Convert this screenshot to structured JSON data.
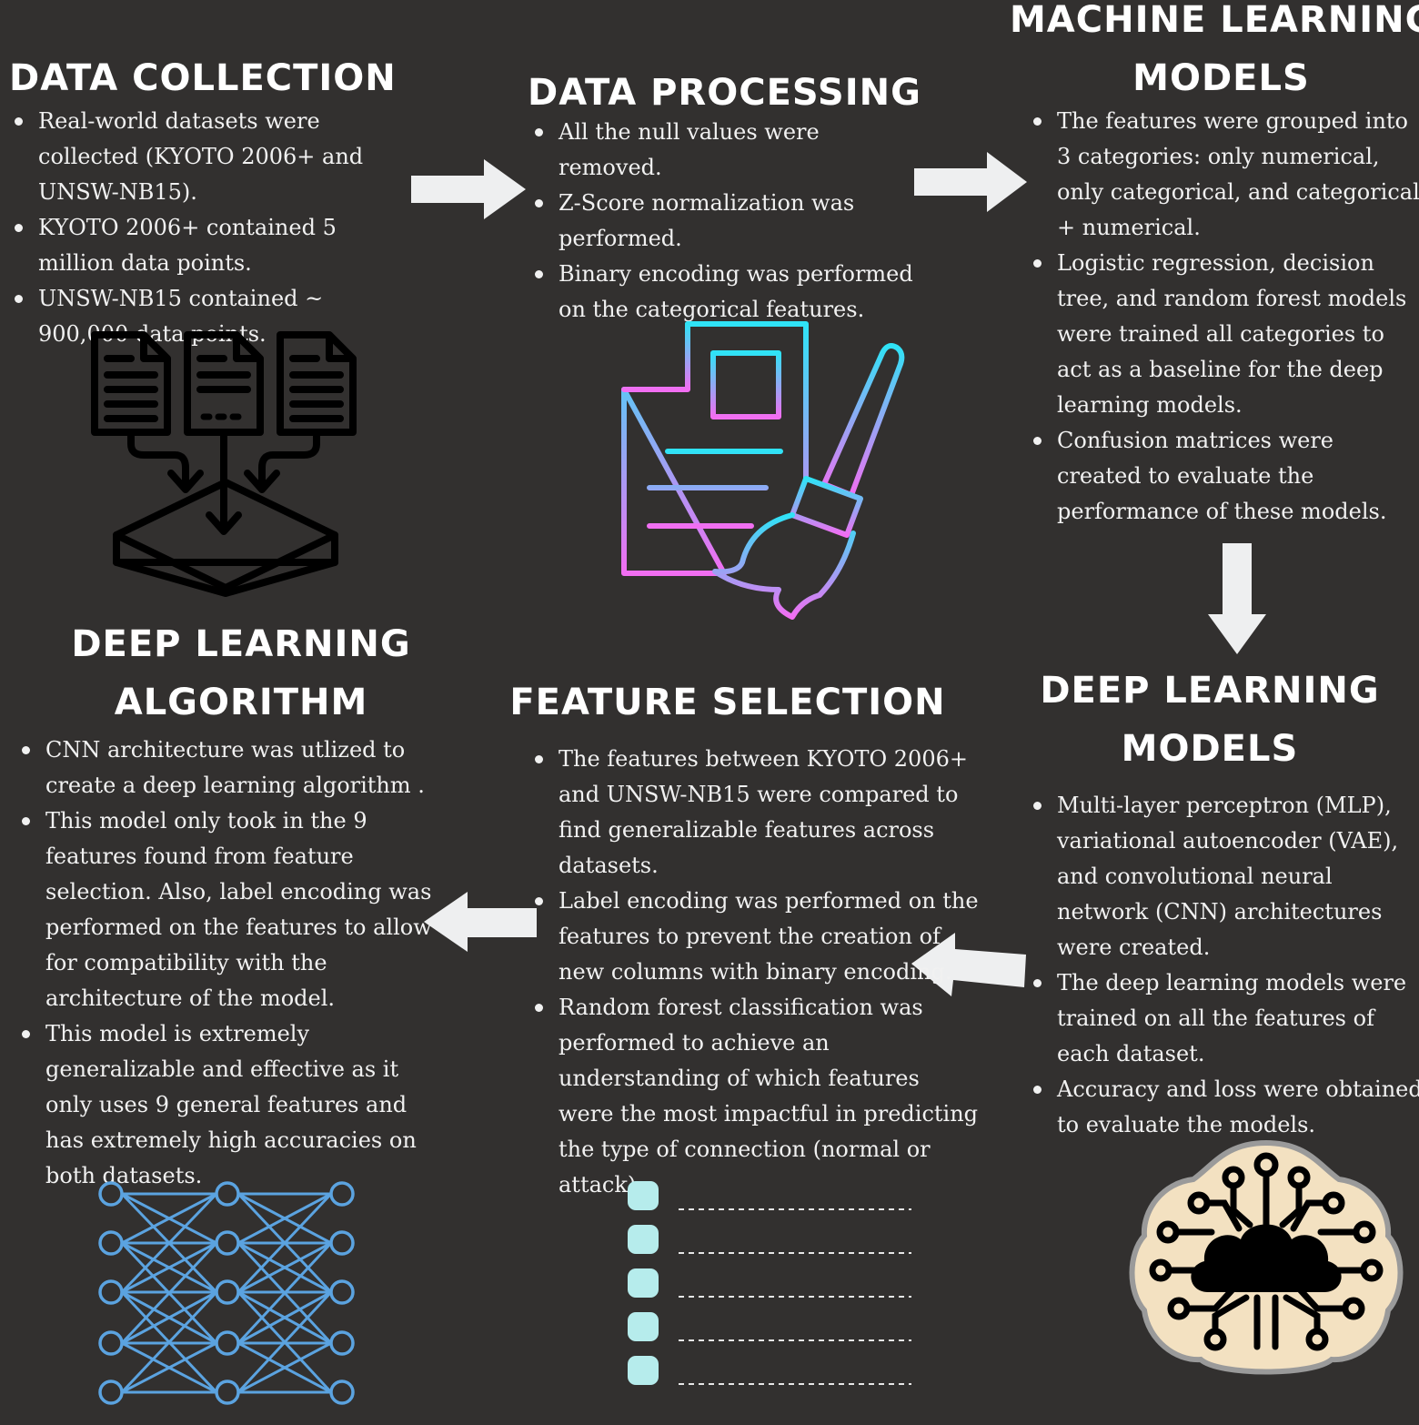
{
  "sections": {
    "data_collection": {
      "title": "DATA COLLECTION",
      "bullets": [
        "Real-world datasets were collected (KYOTO 2006+ and UNSW-NB15).",
        "KYOTO 2006+ contained 5 million data points.",
        "UNSW-NB15 contained ~ 900,000 data points."
      ],
      "icon": "files-merge-icon"
    },
    "data_processing": {
      "title": "DATA PROCESSING",
      "bullets": [
        "All the null values were removed.",
        "Z-Score normalization was performed.",
        "Binary encoding was performed on the categorical features."
      ],
      "icon": "document-broom-icon"
    },
    "ml_models": {
      "title_line1": "MACHINE LEARNING",
      "title_line2": "MODELS",
      "bullets": [
        "The features were grouped into 3 categories: only numerical, only categorical, and categorical + numerical.",
        "Logistic regression, decision tree, and random forest models were trained all categories to act as a baseline for the deep learning models.",
        "Confusion matrices were created to evaluate the performance of these models."
      ]
    },
    "dl_models": {
      "title_line1": "DEEP LEARNING",
      "title_line2": "MODELS",
      "bullets": [
        "Multi-layer perceptron (MLP), variational autoencoder (VAE), and convolutional neural network (CNN) architectures were created.",
        "The deep learning models were trained on all the features of each dataset.",
        "Accuracy and loss were obtained to evaluate the models."
      ],
      "icon": "brain-circuit-icon"
    },
    "feature_selection": {
      "title": "FEATURE SELECTION",
      "bullets": [
        "The features between KYOTO 2006+ and UNSW-NB15 were compared to find generalizable features across datasets.",
        "Label encoding was performed on the features to prevent the creation of new columns with binary encoding.",
        "Random forest classification was performed to achieve an understanding of which features were the most impactful in predicting the type of connection (normal or attack)."
      ],
      "icon": "checklist-icon"
    },
    "dl_algorithm": {
      "title_line1": "DEEP LEARNING",
      "title_line2": "ALGORITHM",
      "bullets": [
        "CNN architecture was utlized to create a deep learning algorithm .",
        "This model only took in the 9 features found from feature selection. Also, label encoding was performed on the features to allow for compatibility with the architecture of the model.",
        "This model is extremely generalizable and effective as it only uses 9 general features and has extremely high accuracies on both datasets."
      ],
      "icon": "neural-network-icon"
    }
  },
  "colors": {
    "background": "#32302f",
    "text": "#f1f1f1",
    "arrow": "#eeeff0",
    "network": "#5ba3e0",
    "checkbox": "#b6ecec",
    "brain_bg": "#f3e1c1",
    "gradient_top": "#2fe3f6",
    "gradient_bottom": "#f26ef2"
  }
}
